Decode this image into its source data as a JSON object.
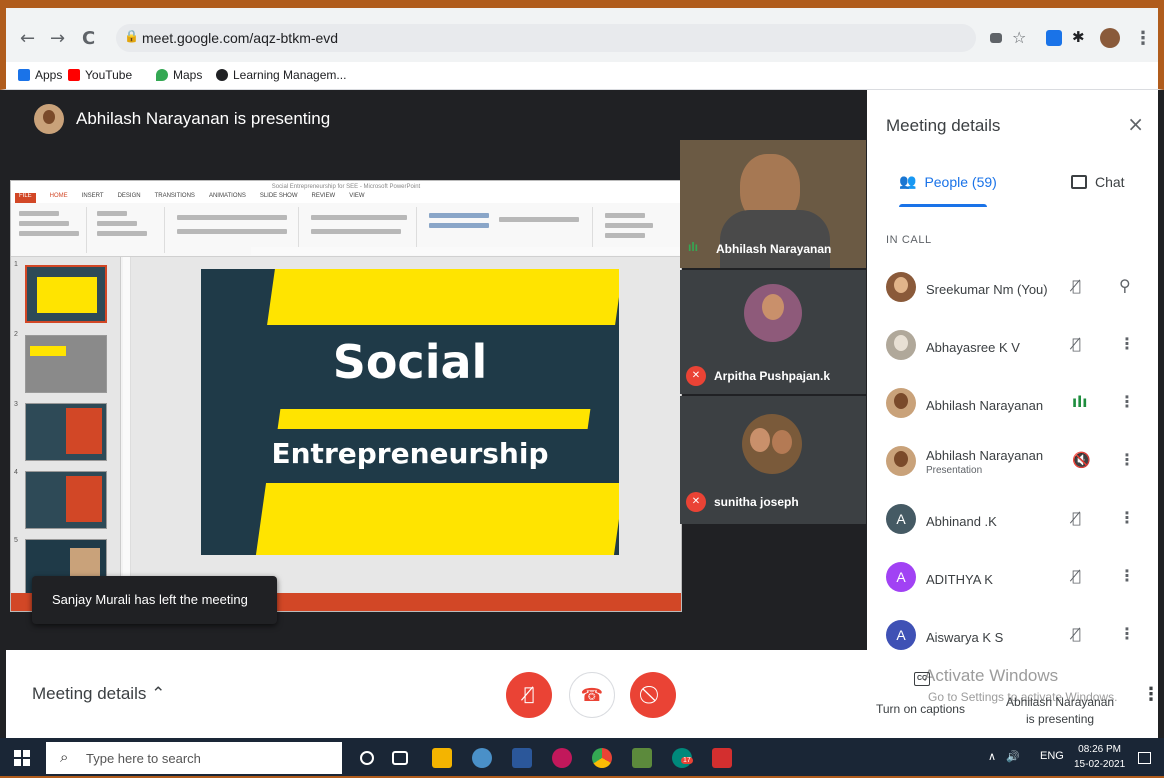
{
  "browser": {
    "url": "meet.google.com/aqz-btkm-evd",
    "nav": {
      "back": "←",
      "forward": "→",
      "reload": "C"
    },
    "bookmarks": [
      {
        "label": "Apps",
        "color": "#1a73e8"
      },
      {
        "label": "YouTube",
        "color": "#ff0000"
      },
      {
        "label": "Maps",
        "color": "#34a853"
      },
      {
        "label": "Learning Managem...",
        "color": "#202124"
      }
    ]
  },
  "meet": {
    "presenter_banner": "Abhilash Narayanan is presenting",
    "slide": {
      "title_line1": "Social",
      "title_line2": "Entrepreneurship"
    },
    "ppt_title": "Social Entrepreneurship for SEE - Microsoft PowerPoint",
    "ppt_tabs": [
      "FILE",
      "HOME",
      "INSERT",
      "DESIGN",
      "TRANSITIONS",
      "ANIMATIONS",
      "SLIDE SHOW",
      "REVIEW",
      "VIEW"
    ],
    "thumb_numbers": [
      "1",
      "2",
      "3",
      "4",
      "5"
    ],
    "tiles": [
      {
        "name": "Abhilash Narayanan",
        "state": "speaking"
      },
      {
        "name": "Arpitha Pushpajan.k",
        "state": "muted"
      },
      {
        "name": "sunitha joseph",
        "state": "muted"
      }
    ],
    "toast": "Sanjay Murali has left the meeting"
  },
  "panel": {
    "title": "Meeting details",
    "close_icon": "×",
    "tab_people": "People (59)",
    "tab_chat": "Chat",
    "section": "IN CALL",
    "people": [
      {
        "name": "Sreekumar Nm (You)",
        "sub": "",
        "avatar": "photo",
        "color": "#8a5a3a",
        "mic": "muted",
        "action": "pin"
      },
      {
        "name": "Abhayasree K V",
        "sub": "",
        "avatar": "photo",
        "color": "#b0a89a",
        "mic": "muted",
        "action": "more"
      },
      {
        "name": "Abhilash Narayanan",
        "sub": "",
        "avatar": "photo",
        "color": "#c9a27a",
        "mic": "speaking",
        "action": "more"
      },
      {
        "name": "Abhilash Narayanan",
        "sub": "Presentation",
        "avatar": "photo",
        "color": "#c9a27a",
        "mic": "presenting",
        "action": "more"
      },
      {
        "name": "Abhinand .K",
        "sub": "",
        "avatar": "A",
        "color": "#455a64",
        "mic": "muted",
        "action": "more"
      },
      {
        "name": "ADITHYA K",
        "sub": "",
        "avatar": "A",
        "color": "#a142f4",
        "mic": "muted",
        "action": "more"
      },
      {
        "name": "Aiswarya K S",
        "sub": "",
        "avatar": "A",
        "color": "#3f51b5",
        "mic": "muted",
        "action": "more"
      }
    ]
  },
  "controls": {
    "meeting_details": "Meeting details",
    "caret": "^",
    "captions": "Turn on captions",
    "cc": "CC",
    "watermark_1": "Activate Windows",
    "watermark_2": "Go to Settings to activate Windows.",
    "presenting_line1": "Abhilash Narayanan",
    "presenting_line2": "is presenting",
    "more": "⋮",
    "accent_red": "#ea4335"
  },
  "taskbar": {
    "search_placeholder": "Type here to search",
    "lang": "ENG",
    "time": "08:26 PM",
    "date": "15-02-2021",
    "badge": "17"
  }
}
